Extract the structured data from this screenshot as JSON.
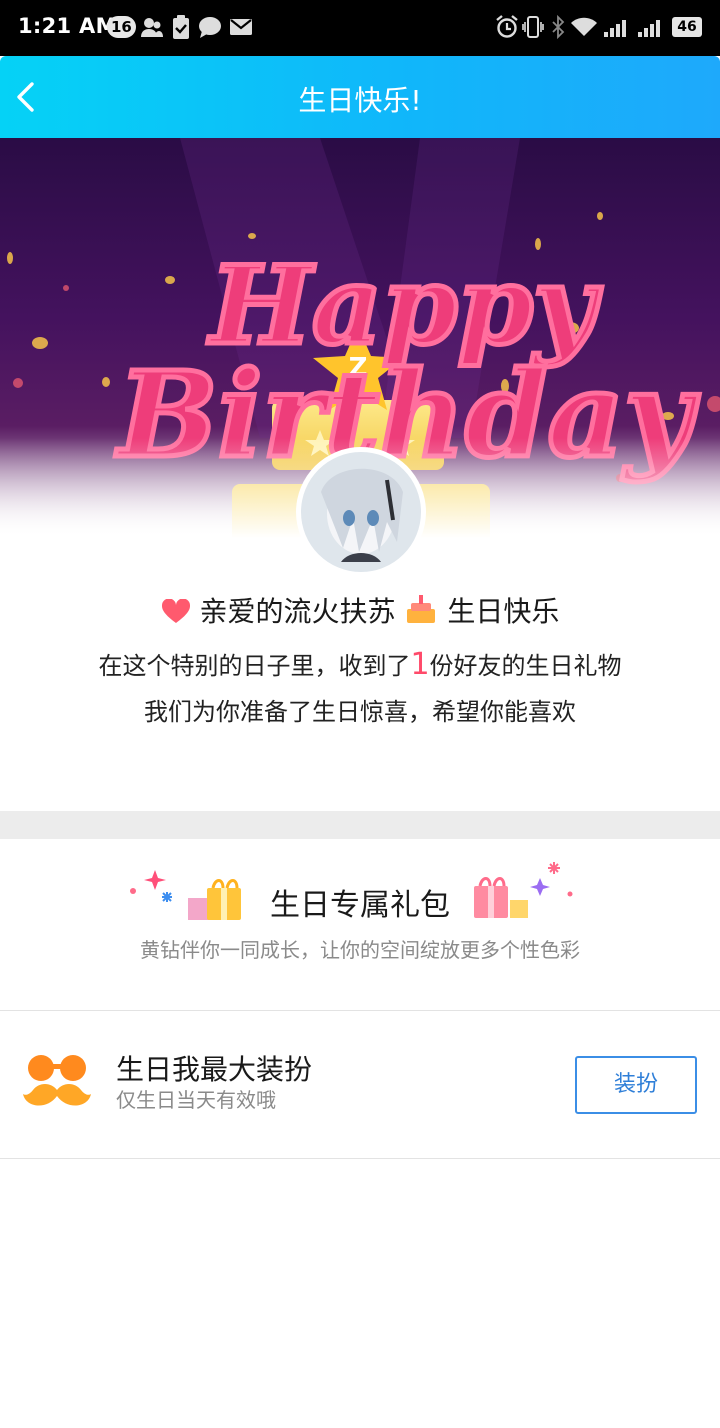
{
  "status_bar": {
    "time": "1:21 AM",
    "notification_count": "16",
    "battery": "46",
    "icons": [
      "contacts-icon",
      "clipboard-check-icon",
      "chat-bubble-icon",
      "mail-icon",
      "alarm-icon",
      "vibrate-icon",
      "bluetooth-icon",
      "wifi-icon",
      "signal-icon",
      "signal-2-icon",
      "battery-icon"
    ]
  },
  "header": {
    "title": "生日快乐!",
    "back_icon": "chevron-left-icon"
  },
  "banner": {
    "lettering": "Happy Birthday",
    "colors": {
      "background_top": "#2a0c45",
      "lettering": "#f0427d",
      "cake": "#f7d458",
      "star": "#ffc42c"
    }
  },
  "greeting": {
    "prefix": "亲爱的流火扶苏",
    "suffix": "生日快乐",
    "line2_before": "在这个特别的日子里，收到了",
    "gift_count": "1",
    "line2_after": "份好友的生日礼物",
    "line3": "我们为你准备了生日惊喜，希望你能喜欢"
  },
  "gift_pack": {
    "title": "生日专属礼包",
    "description": "黄钻伴你一同成长，让你的空间绽放更多个性色彩"
  },
  "dress_item": {
    "title": "生日我最大装扮",
    "subtitle": "仅生日当天有效哦",
    "button_label": "装扮",
    "icon": "mustache-glasses-icon",
    "accent_color": "#ff9a1f"
  }
}
